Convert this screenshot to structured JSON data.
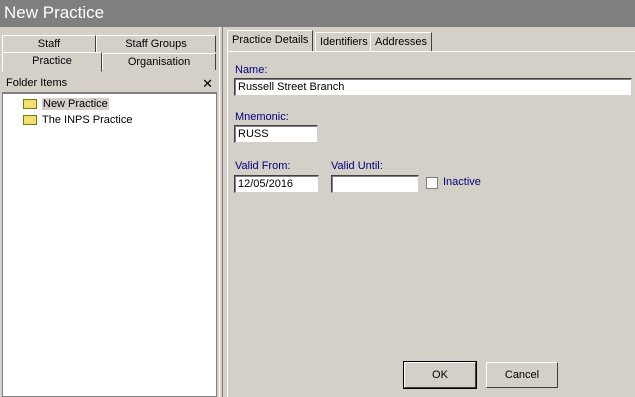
{
  "window": {
    "title": "New Practice"
  },
  "left_tabs": {
    "staff": "Staff",
    "staff_groups": "Staff Groups",
    "practice": "Practice",
    "organisation": "Organisation"
  },
  "folder": {
    "header": "Folder Items",
    "close_glyph": "✕",
    "items": [
      {
        "label": "New Practice"
      },
      {
        "label": "The INPS Practice"
      }
    ]
  },
  "right_tabs": {
    "practice_details": "Practice Details",
    "identifiers": "Identifiers",
    "addresses": "Addresses"
  },
  "form": {
    "name_label": "Name:",
    "name_value": "Russell Street Branch",
    "mnemonic_label": "Mnemonic:",
    "mnemonic_value": "RUSS",
    "valid_from_label": "Valid From:",
    "valid_from_value": "12/05/2016",
    "valid_until_label": "Valid Until:",
    "valid_until_value": "",
    "inactive_label": "Inactive"
  },
  "buttons": {
    "ok": "OK",
    "cancel": "Cancel"
  }
}
